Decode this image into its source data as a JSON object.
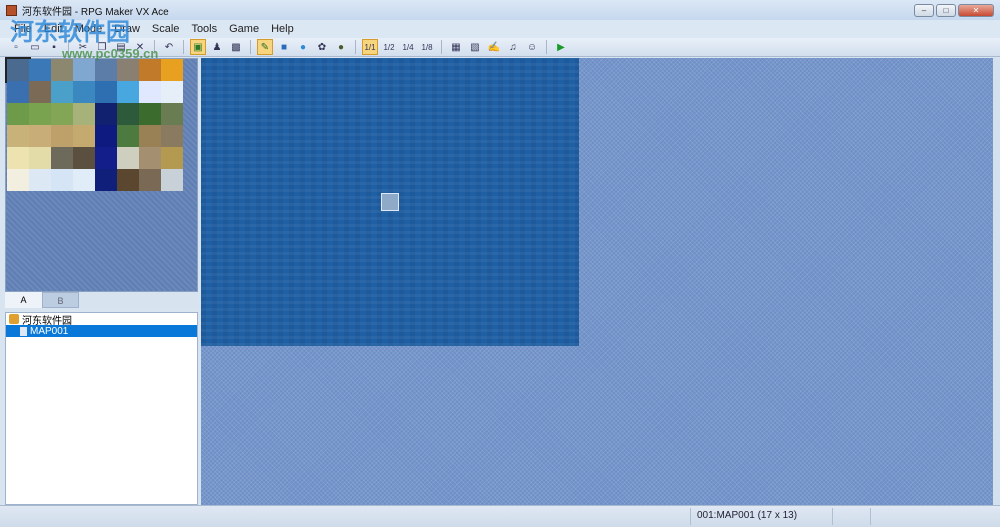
{
  "window": {
    "title": "河东软件园 - RPG Maker VX Ace",
    "minimize": "–",
    "maximize": "□",
    "close": "✕"
  },
  "menu": [
    "File",
    "Edit",
    "Mode",
    "Draw",
    "Scale",
    "Tools",
    "Game",
    "Help"
  ],
  "toolbar": {
    "scale_labels": [
      "1/1",
      "1/2",
      "1/4",
      "1/8"
    ]
  },
  "tileset": {
    "tabs": [
      "A",
      "B"
    ],
    "active_tab": "A",
    "tile_colors": [
      "#4a6b8f",
      "#3b78b8",
      "#8c8870",
      "#7fa7d0",
      "#5c7da8",
      "#8a8072",
      "#c07a2a",
      "#e8a020",
      "#3a70b0",
      "#7b6a55",
      "#4aa0c8",
      "#3b88c0",
      "#2d6fb0",
      "#49a7e0",
      "#dfe8ff",
      "#e6eef8",
      "#6d9b4a",
      "#7aa34f",
      "#82a656",
      "#a7b27a",
      "#122070",
      "#2c5a3a",
      "#3b6c2e",
      "#6a7d52",
      "#c8b27a",
      "#c9ad78",
      "#bda06a",
      "#c5aa70",
      "#0e1a80",
      "#4d7a3e",
      "#9a8055",
      "#8a7a60",
      "#ece3b0",
      "#e3dca8",
      "#6d6a5c",
      "#5b5040",
      "#141e8a",
      "#cfcfc0",
      "#a49070",
      "#b49a50",
      "#f3efe0",
      "#dde8f5",
      "#d5e5f5",
      "#e0ecf8",
      "#10207a",
      "#5b4630",
      "#7a6a55",
      "#c8d0d8"
    ]
  },
  "project_tree": {
    "root": "河东软件园",
    "maps": [
      {
        "label": "MAP001",
        "selected": true
      }
    ]
  },
  "status": {
    "map_info": "001:MAP001 (17 x 13)"
  },
  "watermark": {
    "text": "河东软件园",
    "url": "www.pc0359.cn"
  }
}
